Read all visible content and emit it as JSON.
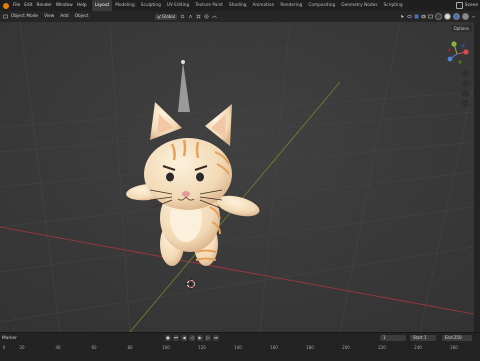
{
  "topbar": {
    "menus": [
      "File",
      "Edit",
      "Render",
      "Window",
      "Help"
    ],
    "workspaces": [
      "Layout",
      "Modeling",
      "Sculpting",
      "UV Editing",
      "Texture Paint",
      "Shading",
      "Animation",
      "Rendering",
      "Compositing",
      "Geometry Nodes",
      "Scripting"
    ],
    "active_workspace": "Layout",
    "scene_label": "Scene"
  },
  "header": {
    "mode": "Object Mode",
    "menus": [
      "View",
      "Add",
      "Object"
    ],
    "orientation": "Global",
    "options_label": "Options"
  },
  "timeline": {
    "label": "Marker",
    "current_frame": "1",
    "start_label": "Start",
    "start_value": "1",
    "end_label": "End",
    "end_value": "250",
    "ticks": [
      "20",
      "40",
      "60",
      "80",
      "100",
      "120",
      "140",
      "160",
      "180",
      "200",
      "220",
      "240",
      "260"
    ],
    "ticks_left": [
      "0"
    ]
  },
  "colors": {
    "accent": "#e87d0d",
    "x_axis": "#b0353e",
    "y_axis": "#6b8a2a"
  }
}
